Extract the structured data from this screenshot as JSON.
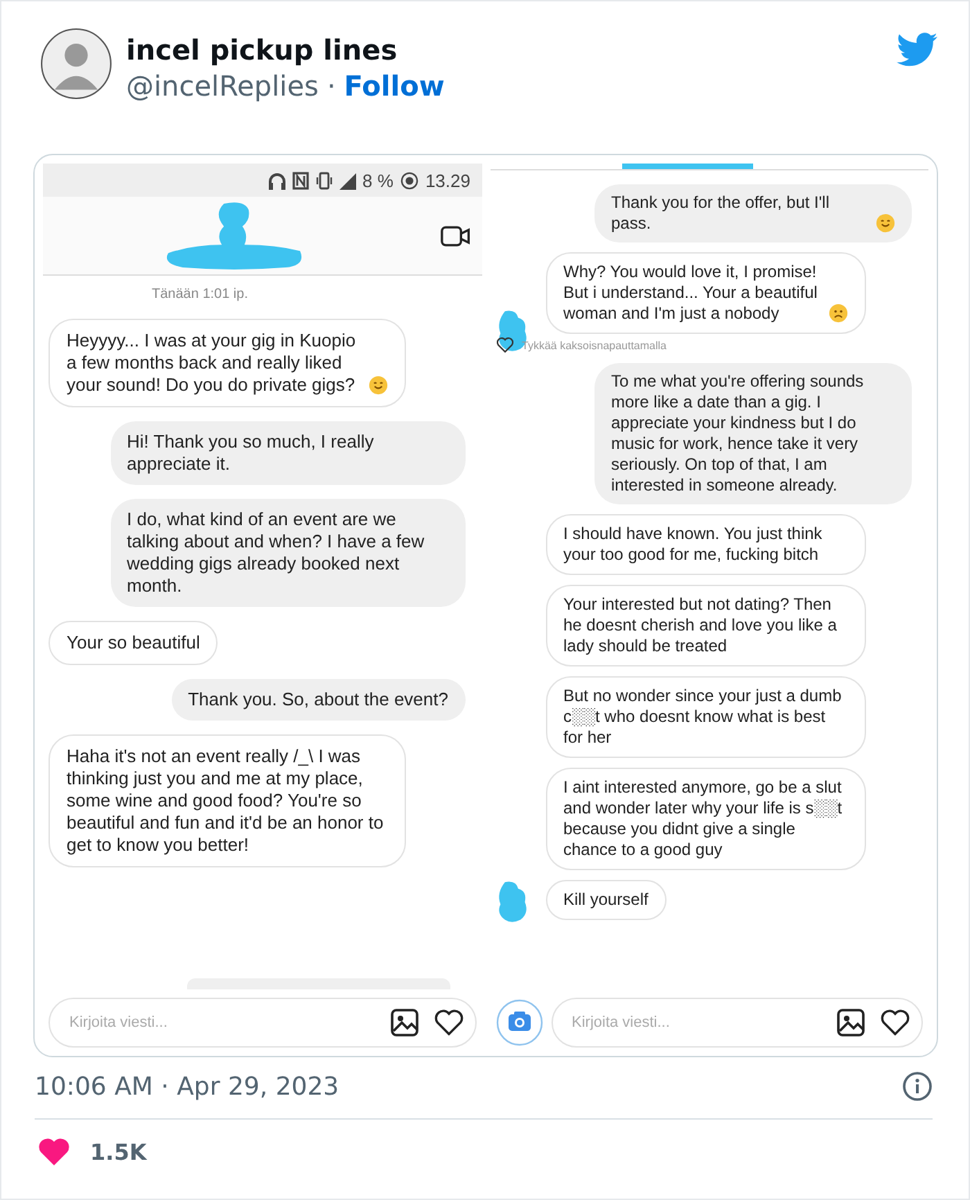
{
  "tweet": {
    "author": "incel pickup lines",
    "handle": "@incelReplies",
    "separator": "·",
    "follow": "Follow",
    "timestamp": "10:06 AM · Apr 29, 2023",
    "likes": "1.5K"
  },
  "panels": [
    {
      "status_bar": {
        "battery": "8 %",
        "time": "13.29"
      },
      "header": true,
      "date": "Tänään 1:01 ip.",
      "messages": [
        {
          "kind": "received",
          "text": "Heyyyy... I was at your gig in Kuopio a few months back and really liked your sound! Do you do private gigs?",
          "emoji": {
            "kind": "smile"
          }
        },
        {
          "kind": "sent",
          "text": "Hi! Thank you so much, I really appreciate it."
        },
        {
          "kind": "sent",
          "text": "I do, what kind of an event are we talking about and when? I have a few wedding gigs already booked next month."
        },
        {
          "kind": "received",
          "text": "Your so beautiful"
        },
        {
          "kind": "sent",
          "text": "Thank you. So, about the event?"
        },
        {
          "kind": "received",
          "text": "Haha it's not an event really /_\\ I was thinking just you and me at my place, some wine and good food? You're so beautiful and fun and it'd be an honor to get to know you better!"
        },
        {
          "kind": "cut"
        }
      ],
      "composer": {
        "placeholder": "Kirjoita viesti...",
        "camera": false
      }
    },
    {
      "header": false,
      "messages": [
        {
          "kind": "sent",
          "text": "Thank you for the offer, but I'll pass.",
          "emoji": {
            "kind": "smile"
          }
        },
        {
          "kind": "received",
          "text": "Why? You would love it, I promise! But i understand... Your a beautiful woman and I'm just a nobody",
          "emoji": {
            "kind": "sad"
          },
          "avatar": true,
          "like_hint": "Tykkää kaksoisnapauttamalla"
        },
        {
          "kind": "sent",
          "text": "To me what you're offering sounds more like a date than a gig. I appreciate your kindness but I do music for work, hence take it very seriously. On top of that, I am interested in someone already."
        },
        {
          "kind": "received",
          "text": "I should have known. You just think your too good for me, fucking bitch",
          "avatar": false
        },
        {
          "kind": "received",
          "text": "Your interested but not dating? Then he doesnt cherish and love you like a lady should be treated",
          "avatar": false
        },
        {
          "kind": "received",
          "text": "But no wonder since your just a dumb c░░t who doesnt know what is best for her",
          "avatar": false
        },
        {
          "kind": "received",
          "text": "I aint interested anymore, go be a slut and wonder later why your life is s░░t because you didnt give a single chance to a good guy",
          "avatar": false
        },
        {
          "kind": "received",
          "text": "Kill yourself",
          "avatar": true
        }
      ],
      "composer": {
        "placeholder": "Kirjoita viesti...",
        "camera": true
      }
    }
  ]
}
